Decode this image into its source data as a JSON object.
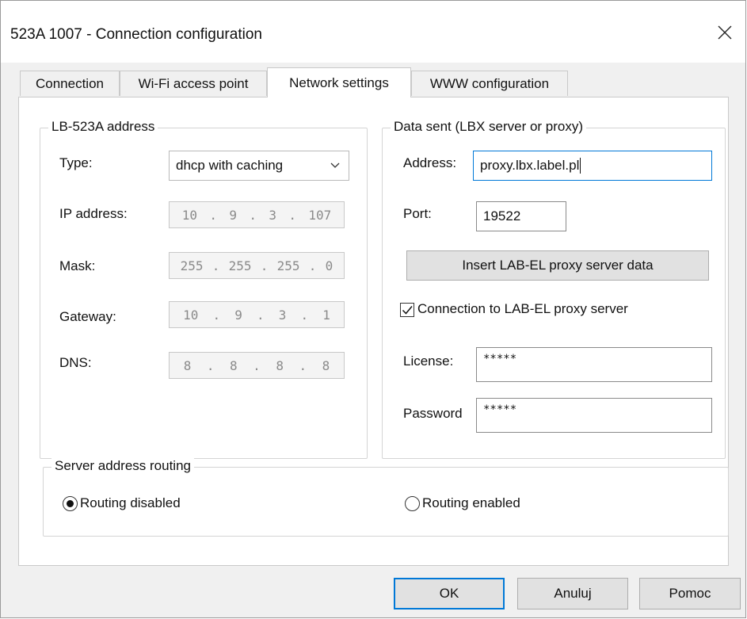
{
  "window": {
    "title": "523A 1007 - Connection configuration",
    "close_icon": "close-icon"
  },
  "tabs": [
    {
      "label": "Connection",
      "active": false
    },
    {
      "label": "Wi-Fi access point",
      "active": false
    },
    {
      "label": "Network settings",
      "active": true
    },
    {
      "label": "WWW configuration",
      "active": false
    }
  ],
  "address_group": {
    "legend": "LB-523A address",
    "type_label": "Type:",
    "type_value": "dhcp with caching",
    "ip_label": "IP address:",
    "ip": [
      "10",
      "9",
      "3",
      "107"
    ],
    "mask_label": "Mask:",
    "mask": [
      "255",
      "255",
      "255",
      "0"
    ],
    "gateway_label": "Gateway:",
    "gateway": [
      "10",
      "9",
      "3",
      "1"
    ],
    "dns_label": "DNS:",
    "dns": [
      "8",
      "8",
      "8",
      "8"
    ]
  },
  "data_group": {
    "legend": "Data sent (LBX server or proxy)",
    "address_label": "Address:",
    "address_value": "proxy.lbx.label.pl",
    "port_label": "Port:",
    "port_value": "19522",
    "insert_button": "Insert LAB-EL proxy server data",
    "proxy_checkbox_label": "Connection to LAB-EL proxy server",
    "proxy_checked": true,
    "license_label": "License:",
    "license_value": "*****",
    "password_label": "Password",
    "password_value": "*****"
  },
  "routing_group": {
    "legend": "Server address routing",
    "disabled_label": "Routing disabled",
    "enabled_label": "Routing enabled",
    "selected": "disabled"
  },
  "footer": {
    "ok": "OK",
    "cancel": "Anuluj",
    "help": "Pomoc"
  },
  "colors": {
    "focus_border": "#0078d7",
    "dialog_bg": "#f0f0f0"
  }
}
